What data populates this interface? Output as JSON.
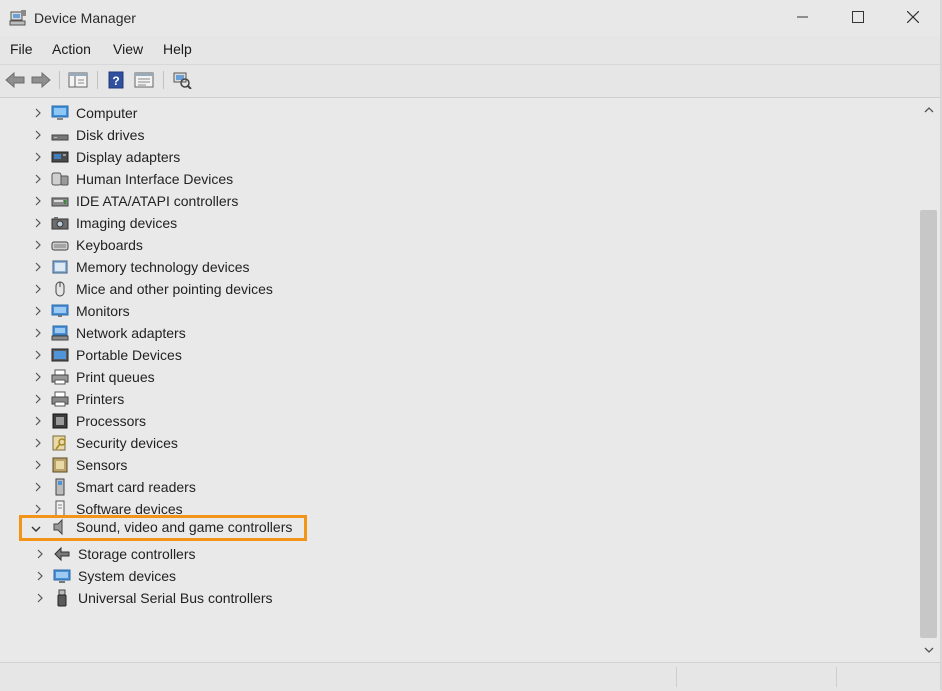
{
  "window": {
    "title": "Device Manager"
  },
  "menu": {
    "items": [
      "File",
      "Action",
      "View",
      "Help"
    ]
  },
  "toolbar": {
    "buttons": [
      "back-icon",
      "forward-icon",
      "console-tree-icon",
      "help-icon",
      "properties-icon",
      "scan-hardware-icon"
    ]
  },
  "tree": {
    "items": [
      {
        "label": "Computer",
        "icon": "computer-icon",
        "expanded": false
      },
      {
        "label": "Disk drives",
        "icon": "disk-drive-icon",
        "expanded": false
      },
      {
        "label": "Display adapters",
        "icon": "display-adapter-icon",
        "expanded": false
      },
      {
        "label": "Human Interface Devices",
        "icon": "hid-icon",
        "expanded": false
      },
      {
        "label": "IDE ATA/ATAPI controllers",
        "icon": "ide-controller-icon",
        "expanded": false
      },
      {
        "label": "Imaging devices",
        "icon": "camera-icon",
        "expanded": false
      },
      {
        "label": "Keyboards",
        "icon": "keyboard-icon",
        "expanded": false
      },
      {
        "label": "Memory technology devices",
        "icon": "memory-icon",
        "expanded": false
      },
      {
        "label": "Mice and other pointing devices",
        "icon": "mouse-icon",
        "expanded": false
      },
      {
        "label": "Monitors",
        "icon": "monitor-icon",
        "expanded": false
      },
      {
        "label": "Network adapters",
        "icon": "network-adapter-icon",
        "expanded": false
      },
      {
        "label": "Portable Devices",
        "icon": "portable-device-icon",
        "expanded": false
      },
      {
        "label": "Print queues",
        "icon": "print-queue-icon",
        "expanded": false
      },
      {
        "label": "Printers",
        "icon": "printer-icon",
        "expanded": false
      },
      {
        "label": "Processors",
        "icon": "processor-icon",
        "expanded": false
      },
      {
        "label": "Security devices",
        "icon": "security-device-icon",
        "expanded": false
      },
      {
        "label": "Sensors",
        "icon": "sensor-icon",
        "expanded": false
      },
      {
        "label": "Smart card readers",
        "icon": "smart-card-icon",
        "expanded": false
      },
      {
        "label": "Software devices",
        "icon": "software-device-icon",
        "expanded": false
      },
      {
        "label": "Sound, video and game controllers",
        "icon": "speaker-icon",
        "expanded": true
      },
      {
        "label": "Storage controllers",
        "icon": "storage-controller-icon",
        "expanded": false
      },
      {
        "label": "System devices",
        "icon": "system-device-icon",
        "expanded": false
      },
      {
        "label": "Universal Serial Bus controllers",
        "icon": "usb-icon",
        "expanded": false
      }
    ]
  },
  "highlight_color": "#f29418"
}
